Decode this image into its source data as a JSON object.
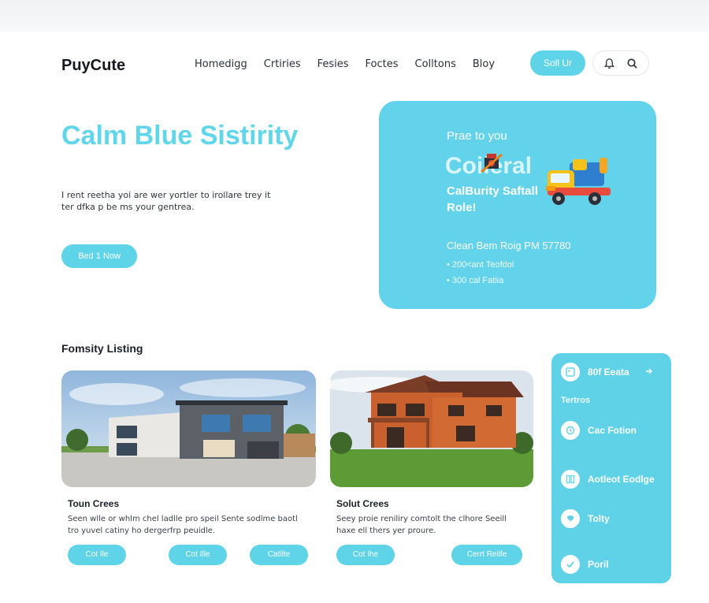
{
  "brand": {
    "logo": "PuyCute"
  },
  "nav": {
    "links": [
      "Homedigg",
      "Crtiries",
      "Fesies",
      "Foctes",
      "Colltons",
      "Bloy"
    ],
    "cta": "Soll Ur",
    "icons": [
      "bell-icon",
      "search-icon"
    ]
  },
  "hero": {
    "title": "Calm Blue Sistirity",
    "description": "I rent reetha yoi are wer yortler to irollare trey it ter dfka p be ms your gentrea.",
    "button": "Bed 1 Now"
  },
  "promo": {
    "heading": "Prae to you",
    "big_text": "Coileral",
    "subtitle": "CalBurity Saftall Role!",
    "info": "Clean Bem Roig PM 57780",
    "bullets": [
      "• 200<ant Teofdoi",
      "• 300 cal Fatiia"
    ],
    "colors": {
      "background": "#62d3ea"
    }
  },
  "listings": {
    "section_title": "Fomsity Listing",
    "cards": [
      {
        "title": "Toun Crees",
        "description": "Seen wlle or whlm chel ladlle pro speil Sente sodlme baotl tro yuvel catiny ho dergerfrp peuidle.",
        "buttons": [
          "Cot Ile",
          "Cot Ille",
          "Catilte"
        ]
      },
      {
        "title": "Solut Crees",
        "description": "Seey proie reniliry comtolt the clhore Seeill haxe ell thers yer proure.",
        "buttons": [
          "Cot Ihe",
          "Cerrt Relife"
        ]
      }
    ]
  },
  "sidebar": {
    "top_item": "80f Eeata",
    "heading": "Tertros",
    "items": [
      {
        "label": "Cac Fotion",
        "icon": "clock-icon"
      },
      {
        "label": "Aotleot Eodlge",
        "icon": "grid-icon"
      },
      {
        "label": "Tolty",
        "icon": "chat-icon"
      },
      {
        "label": "Poril",
        "icon": "check-icon"
      }
    ],
    "colors": {
      "background": "#5fd2e8"
    }
  },
  "theme": {
    "accent": "#5fd4e8",
    "title_color": "#61d6ea"
  }
}
